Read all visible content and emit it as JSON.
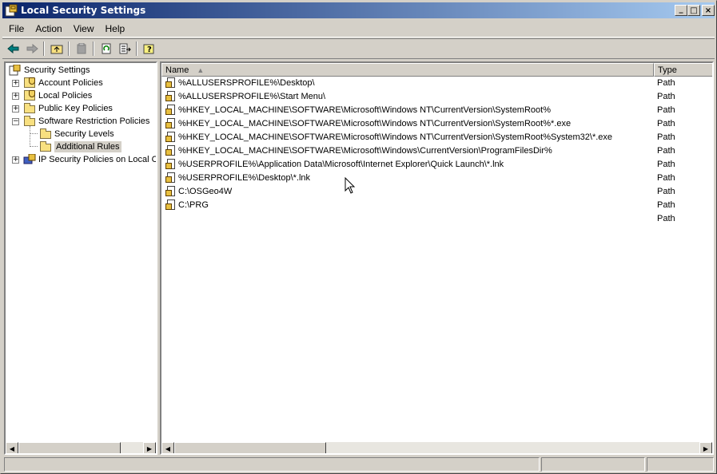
{
  "window": {
    "title": "Local Security Settings",
    "controls": {
      "minimize": "_",
      "maximize": "□",
      "close": "×"
    }
  },
  "menu": [
    "File",
    "Action",
    "View",
    "Help"
  ],
  "toolbar": {
    "icons": [
      "back-arrow-icon",
      "forward-arrow-icon",
      "up-folder-icon",
      "delete-icon",
      "refresh-icon",
      "export-list-icon",
      "help-icon"
    ]
  },
  "tree": {
    "root": "Security Settings",
    "items": [
      {
        "label": "Account Policies"
      },
      {
        "label": "Local Policies"
      },
      {
        "label": "Public Key Policies"
      },
      {
        "label": "Software Restriction Policies"
      },
      {
        "label": "Security Levels"
      },
      {
        "label": "Additional Rules"
      },
      {
        "label": "IP Security Policies on Local Co"
      }
    ]
  },
  "list": {
    "columns": {
      "name": "Name",
      "type": "Type"
    },
    "rows": [
      {
        "name": "%ALLUSERSPROFILE%\\Desktop\\",
        "type": "Path"
      },
      {
        "name": "%ALLUSERSPROFILE%\\Start Menu\\",
        "type": "Path"
      },
      {
        "name": "%HKEY_LOCAL_MACHINE\\SOFTWARE\\Microsoft\\Windows NT\\CurrentVersion\\SystemRoot%",
        "type": "Path"
      },
      {
        "name": "%HKEY_LOCAL_MACHINE\\SOFTWARE\\Microsoft\\Windows NT\\CurrentVersion\\SystemRoot%*.exe",
        "type": "Path"
      },
      {
        "name": "%HKEY_LOCAL_MACHINE\\SOFTWARE\\Microsoft\\Windows NT\\CurrentVersion\\SystemRoot%System32\\*.exe",
        "type": "Path"
      },
      {
        "name": "%HKEY_LOCAL_MACHINE\\SOFTWARE\\Microsoft\\Windows\\CurrentVersion\\ProgramFilesDir%",
        "type": "Path"
      },
      {
        "name": "%USERPROFILE%\\Application Data\\Microsoft\\Internet Explorer\\Quick Launch\\*.lnk",
        "type": "Path"
      },
      {
        "name": "%USERPROFILE%\\Desktop\\*.lnk",
        "type": "Path"
      },
      {
        "name": "C:\\OSGeo4W",
        "type": "Path"
      },
      {
        "name": "C:\\PRG",
        "type": "Path"
      },
      {
        "name": "",
        "type": "Path"
      }
    ]
  },
  "colors": {
    "title_start": "#0a246a",
    "title_end": "#a6caf0",
    "selection": "#d4d0c8"
  }
}
